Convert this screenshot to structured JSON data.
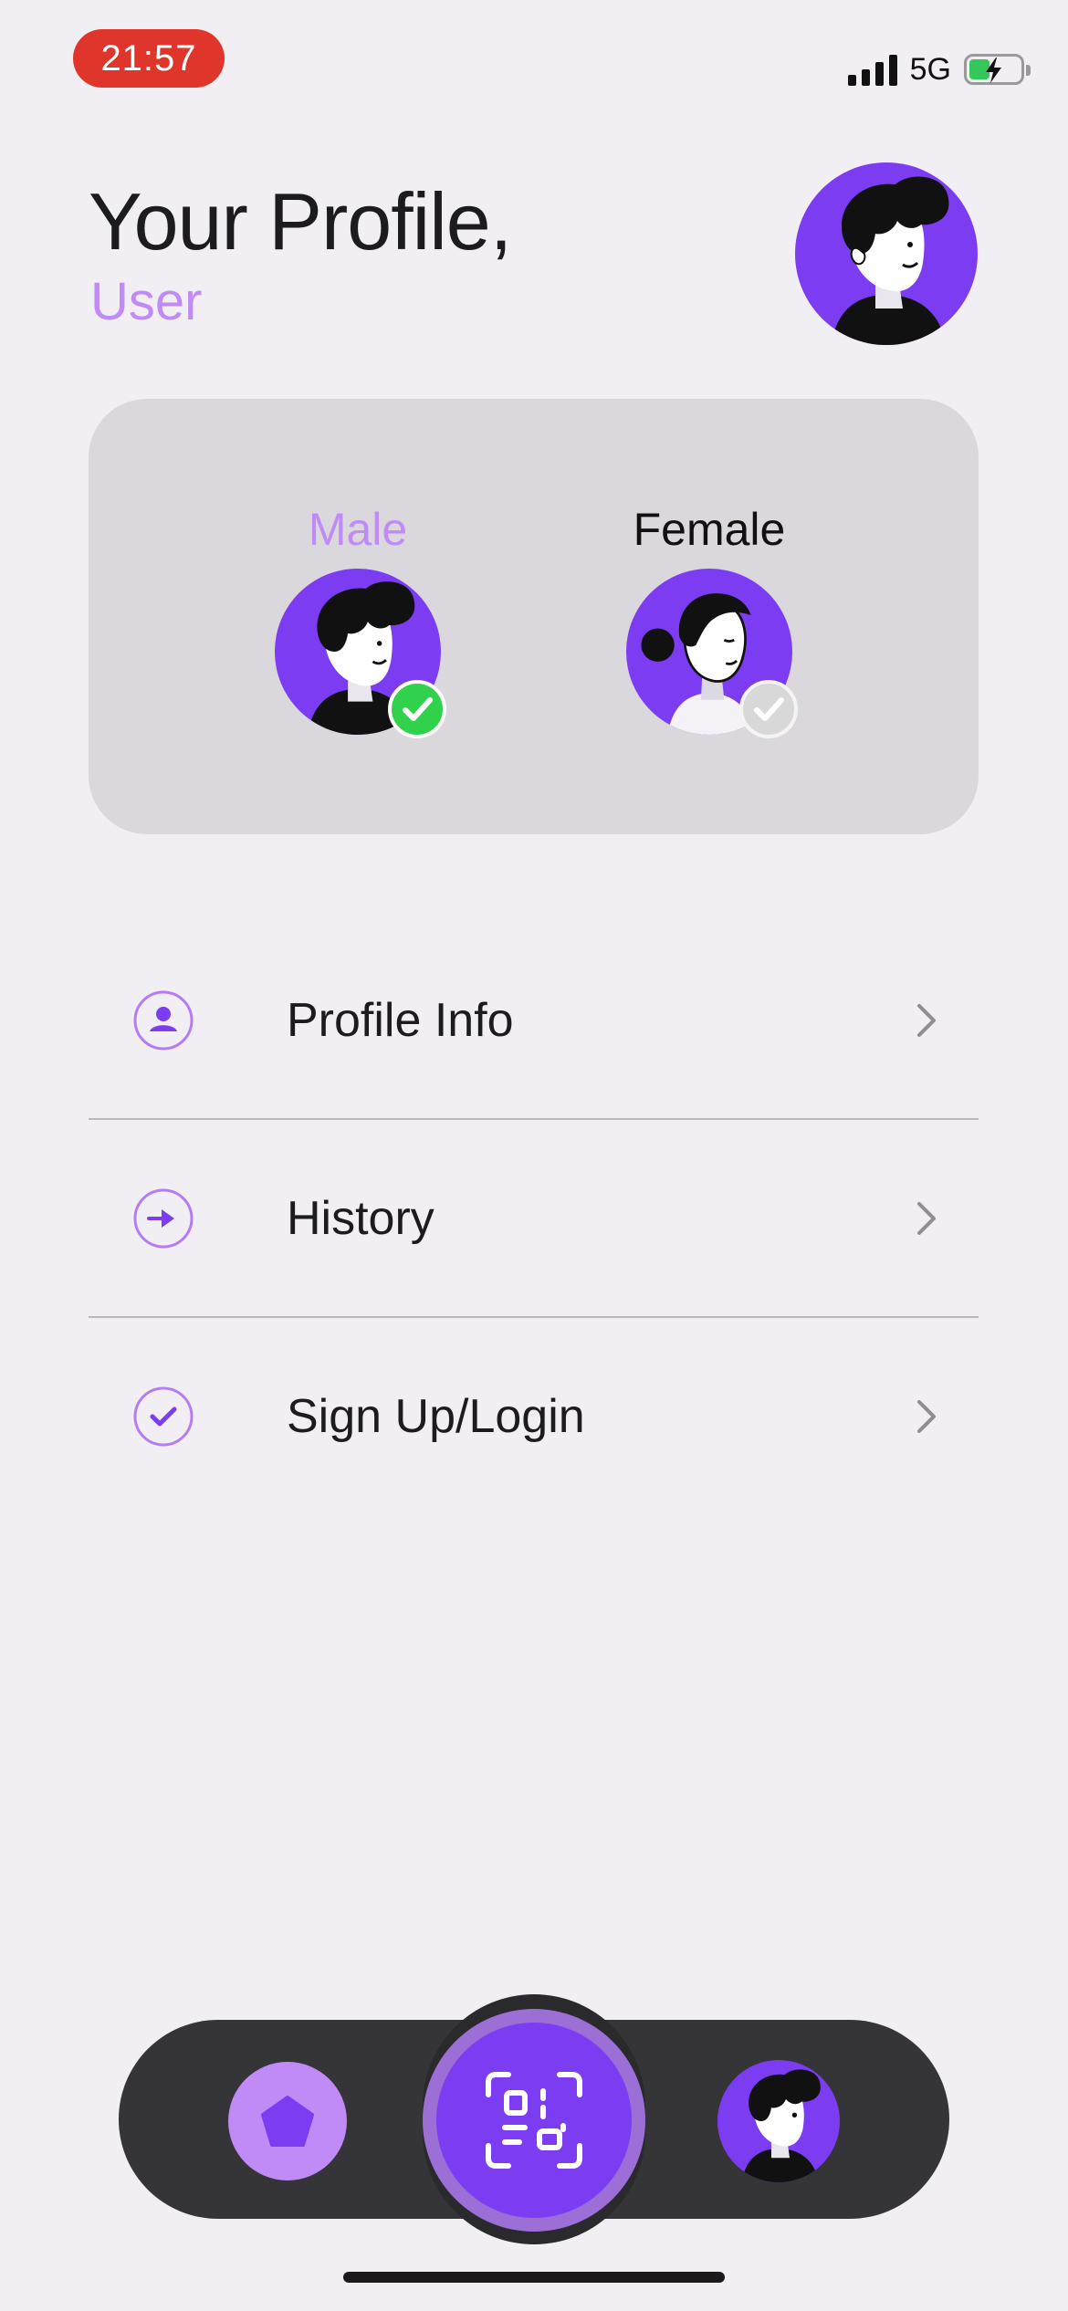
{
  "status_bar": {
    "time": "21:57",
    "network": "5G",
    "icons": [
      "signal-icon",
      "battery-charging-icon"
    ],
    "colors": {
      "time_pill": "#e0352b",
      "battery_fill": "#35c759"
    }
  },
  "header": {
    "title": "Your Profile,",
    "subtitle": "User",
    "avatar": "male-avatar"
  },
  "gender": {
    "options": [
      {
        "label": "Male",
        "selected": true,
        "icon": "male-avatar"
      },
      {
        "label": "Female",
        "selected": false,
        "icon": "female-avatar"
      }
    ]
  },
  "menu": {
    "items": [
      {
        "label": "Profile Info",
        "icon": "user-circle-icon"
      },
      {
        "label": "History",
        "icon": "arrow-circle-icon"
      },
      {
        "label": "Sign Up/Login",
        "icon": "check-circle-icon"
      }
    ]
  },
  "tabbar": {
    "items": [
      {
        "icon": "pentagon-home-icon"
      },
      {
        "icon": "qr-scan-icon"
      },
      {
        "icon": "profile-avatar-icon"
      }
    ]
  },
  "colors": {
    "accent": "#7c3cf2",
    "accent_light": "#c08af7",
    "background": "#f1eff4",
    "card": "#dad8dc",
    "tabbar": "#353437"
  }
}
